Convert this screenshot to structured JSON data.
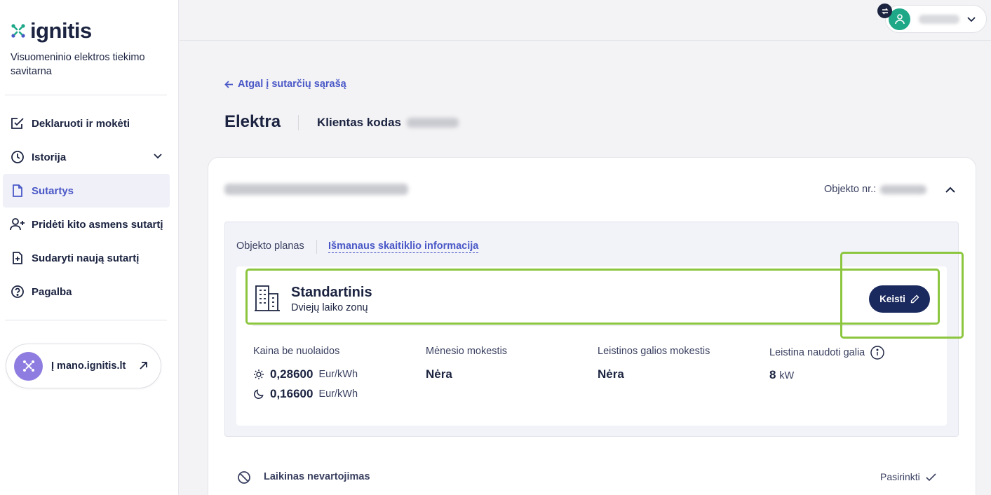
{
  "brand": {
    "name": "ignitis",
    "subtitle": "Visuomeninio elektros tiekimo savitarna"
  },
  "sidebar": {
    "items": [
      {
        "label": "Deklaruoti ir mokėti",
        "icon": "checkbox-edit-icon"
      },
      {
        "label": "Istorija",
        "icon": "clock-icon"
      },
      {
        "label": "Sutartys",
        "icon": "document-icon",
        "active": true
      },
      {
        "label": "Pridėti kito asmens sutartį",
        "icon": "add-user-icon"
      },
      {
        "label": "Sudaryti naują sutartį",
        "icon": "document-plus-icon"
      },
      {
        "label": "Pagalba",
        "icon": "help-icon"
      }
    ],
    "external_link": "Į mano.ignitis.lt"
  },
  "main": {
    "back_link": "Atgal į sutarčių sąrašą",
    "title": "Elektra",
    "client_code_label": "Klientas kodas",
    "object_nr_label": "Objekto nr.:",
    "tabs": [
      {
        "label": "Objekto planas",
        "active": true
      },
      {
        "label": "Išmanaus skaitiklio informacija"
      }
    ],
    "plan": {
      "name": "Standartinis",
      "description": "Dviejų laiko zonų",
      "change_button": "Keisti"
    },
    "price_label": "Kaina be nuolaidos",
    "rates": [
      {
        "icon": "sun-icon",
        "value": "0,28600",
        "unit": "Eur/kWh"
      },
      {
        "icon": "moon-icon",
        "value": "0,16600",
        "unit": "Eur/kWh"
      }
    ],
    "monthly_fee": {
      "label": "Mėnesio mokestis",
      "value": "Nėra"
    },
    "power_fee": {
      "label": "Leistinos galios mokestis",
      "value": "Nėra"
    },
    "allowed_power": {
      "label": "Leistina naudoti galia",
      "value": "8",
      "unit": "kW"
    },
    "suspension": {
      "label": "Laikinas nevartojimas",
      "action": "Pasirinkti"
    }
  },
  "colors": {
    "accent": "#4a58c7",
    "primary_button": "#1b2a5e",
    "highlight": "#8cc63f",
    "avatar": "#1fa888"
  }
}
